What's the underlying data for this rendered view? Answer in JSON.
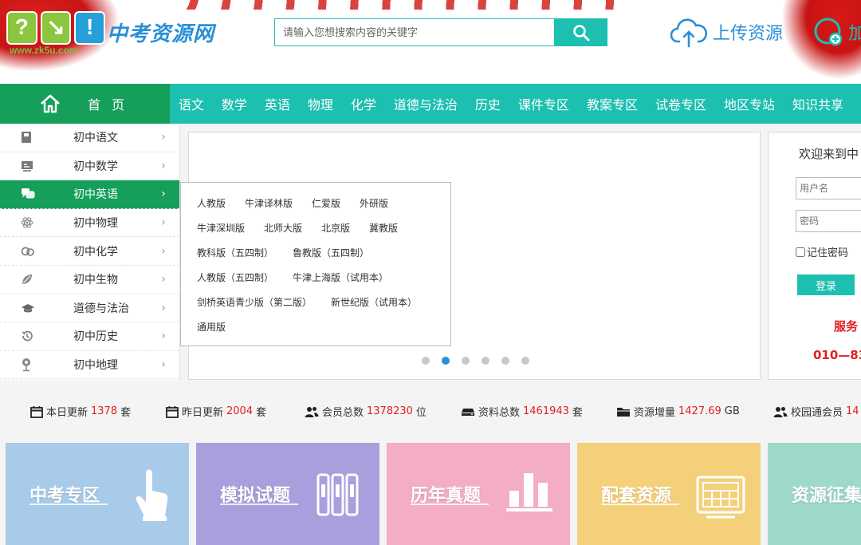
{
  "header": {
    "logo_mark": [
      "?",
      "↘",
      "!"
    ],
    "logo_url": "www.zk5u.com",
    "logo_text": "中考资源网",
    "search": {
      "placeholder": "请输入您想搜索内容的关键字"
    },
    "upload_label": "上传资源",
    "join_label": "加"
  },
  "nav": {
    "home_label": "首页",
    "items": [
      "语文",
      "数学",
      "英语",
      "物理",
      "化学",
      "道德与法治",
      "历史",
      "课件专区",
      "教案专区",
      "试卷专区",
      "地区专站",
      "知识共享"
    ]
  },
  "sidebar": {
    "items": [
      {
        "label": "初中语文",
        "icon": "book-icon"
      },
      {
        "label": "初中数学",
        "icon": "blackboard-icon"
      },
      {
        "label": "初中英语",
        "icon": "speech-bubble-icon",
        "active": true
      },
      {
        "label": "初中物理",
        "icon": "atom-icon"
      },
      {
        "label": "初中化学",
        "icon": "flask-icon"
      },
      {
        "label": "初中生物",
        "icon": "leaf-icon"
      },
      {
        "label": "道德与法治",
        "icon": "mortarboard-icon"
      },
      {
        "label": "初中历史",
        "icon": "history-clock-icon"
      },
      {
        "label": "初中地理",
        "icon": "map-pin-icon"
      }
    ]
  },
  "dropdown": {
    "rows": [
      [
        "人教版",
        "牛津译林版",
        "仁爱版",
        "外研版"
      ],
      [
        "牛津深圳版",
        "北师大版",
        "北京版",
        "冀教版"
      ],
      [
        "教科版（五四制）",
        "鲁教版（五四制）"
      ],
      [
        "人教版（五四制）",
        "牛津上海版（试用本）"
      ],
      [
        "剑桥英语青少版（第二版）",
        "新世纪版（试用本）"
      ],
      [
        "通用版"
      ]
    ]
  },
  "banner": {
    "slide_count": 6,
    "active_index": 1
  },
  "login": {
    "title": "欢迎来到中",
    "user_placeholder": "用户名",
    "pass_placeholder": "密码",
    "remember_label": "记住密码",
    "login_label": "登录",
    "service_label": "服务",
    "phone": "010—83"
  },
  "stats": [
    {
      "label": "本日更新",
      "value": "1378",
      "unit": "套",
      "icon": "calendar-icon"
    },
    {
      "label": "昨日更新",
      "value": "2004",
      "unit": "套",
      "icon": "calendar-icon"
    },
    {
      "label": "会员总数",
      "value": "1378230",
      "unit": "位",
      "icon": "users-icon"
    },
    {
      "label": "资料总数",
      "value": "1461943",
      "unit": "套",
      "icon": "harddrive-icon"
    },
    {
      "label": "资源增量",
      "value": "1427.69",
      "unit": "GB",
      "icon": "folder-icon"
    },
    {
      "label": "校园通会员",
      "value": "14",
      "unit": "",
      "icon": "users-icon"
    }
  ],
  "tiles": [
    {
      "label": "中考专区",
      "color": "#a7cbe8",
      "icon": "hand-pointer-icon"
    },
    {
      "label": "模拟试题",
      "color": "#a99fdc",
      "icon": "binders-icon"
    },
    {
      "label": "历年真题",
      "color": "#f4aec4",
      "icon": "bar-chart-icon"
    },
    {
      "label": "配套资源",
      "color": "#f4d07a",
      "icon": "calendar-board-icon"
    },
    {
      "label": "资源征集",
      "color": "#9fd9c9",
      "icon": ""
    }
  ],
  "colors": {
    "teal": "#1cbfb0",
    "green": "#159f5a",
    "blue": "#2a8fd8",
    "red": "#e02020"
  }
}
